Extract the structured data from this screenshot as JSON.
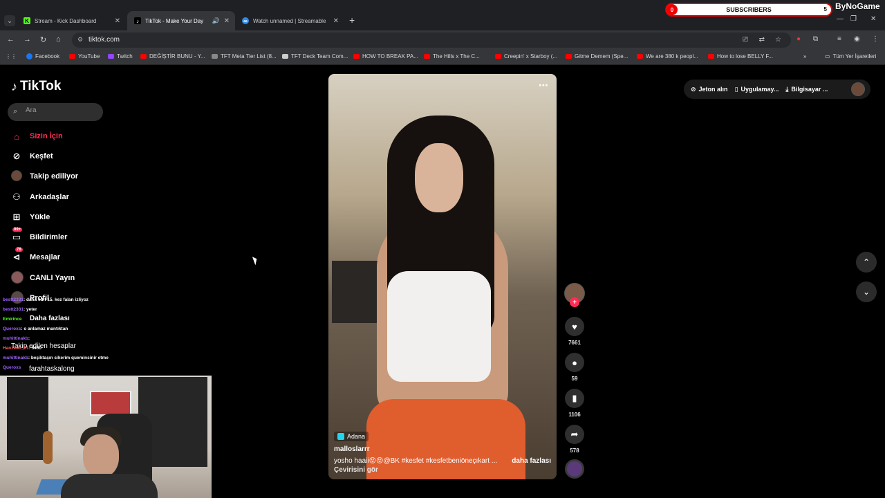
{
  "browser": {
    "tabs": [
      {
        "title": "Stream - Kick Dashboard",
        "icon": "kick-icon"
      },
      {
        "title": "TikTok - Make Your Day",
        "icon": "tiktok-icon",
        "active": true
      },
      {
        "title": "Watch unnamed | Streamable",
        "icon": "streamable-icon"
      }
    ],
    "url": "tiktok.com",
    "bookmarks": [
      {
        "label": "Facebook",
        "color": "#1877f2"
      },
      {
        "label": "YouTube",
        "color": "#ff0000"
      },
      {
        "label": "Twitch",
        "color": "#9146ff"
      },
      {
        "label": "DEĞİŞTİR BUNU - Y...",
        "color": "#ff0000"
      },
      {
        "label": "TFT Meta Tier List (8...",
        "color": "#888888"
      },
      {
        "label": "TFT Deck Team Com...",
        "color": "#cccccc"
      },
      {
        "label": "HOW TO BREAK PA...",
        "color": "#ff0000"
      },
      {
        "label": "The Hills x The C...",
        "color": "#ff0000"
      },
      {
        "label": "Creepin' x Starboy (...",
        "color": "#ff0000"
      },
      {
        "label": "Gitme Demem (Spe...",
        "color": "#ff0000"
      },
      {
        "label": "We are 380 k peopl...",
        "color": "#ff0000"
      },
      {
        "label": "How to lose BELLY F...",
        "color": "#ff0000"
      }
    ],
    "bookmarks_folder": "Tüm Yer İşaretleri"
  },
  "overlay": {
    "sub_left": "0",
    "sub_label": "SUBSCRIBERS",
    "sub_right": "5",
    "brand": "ByNoGame"
  },
  "tiktok": {
    "logo": "TikTok",
    "search_placeholder": "Ara",
    "nav": [
      {
        "label": "Sizin İçin",
        "icon": "home-icon",
        "active": true
      },
      {
        "label": "Keşfet",
        "icon": "compass-icon"
      },
      {
        "label": "Takip ediliyor",
        "icon": "avatar-icon"
      },
      {
        "label": "Arkadaşlar",
        "icon": "friends-icon"
      },
      {
        "label": "Yükle",
        "icon": "upload-icon"
      },
      {
        "label": "Bildirimler",
        "icon": "inbox-icon",
        "badge": "99+"
      },
      {
        "label": "Mesajlar",
        "icon": "send-icon",
        "badge": "78"
      },
      {
        "label": "CANLI Yayın",
        "icon": "live-icon"
      },
      {
        "label": "Profil",
        "icon": "profile-icon"
      }
    ],
    "more_label": "Daha fazlası",
    "following_accounts_label": "Takip edilen hesaplar",
    "account_preview": "farahtaskalong",
    "header": {
      "coins": "Jeton alın",
      "app": "Uygulamay...",
      "desktop": "Bilgisayar ..."
    },
    "video": {
      "location": "Adana",
      "username": "malloslarrr",
      "description": "yosho haaii😝😝@BK  #kesfet  #kesfetbeniöneçıkart  ...",
      "more": "daha fazlası",
      "translate": "Çevirisini gör",
      "likes": "7661",
      "comments": "59",
      "saves": "1106",
      "shares": "578"
    }
  },
  "chat": [
    {
      "user": "bestt2331",
      "msg": ": daha edit 15. kez falan izliyoz"
    },
    {
      "user": "bestt2331",
      "msg": ": yeter"
    },
    {
      "user": "Emirince",
      "msg": ""
    },
    {
      "user": "Queroxs",
      "msg": ": o anlamaz mantıktan"
    },
    {
      "user": "muhittinakb",
      "msg": ":"
    },
    {
      "user": "Hanzwar_01",
      "msg": ": 5400"
    },
    {
      "user": "muhittinakb",
      "msg": ": beşiktaşın sikerim queminsinir etme"
    },
    {
      "user": "Queroxs",
      "msg": ""
    }
  ]
}
